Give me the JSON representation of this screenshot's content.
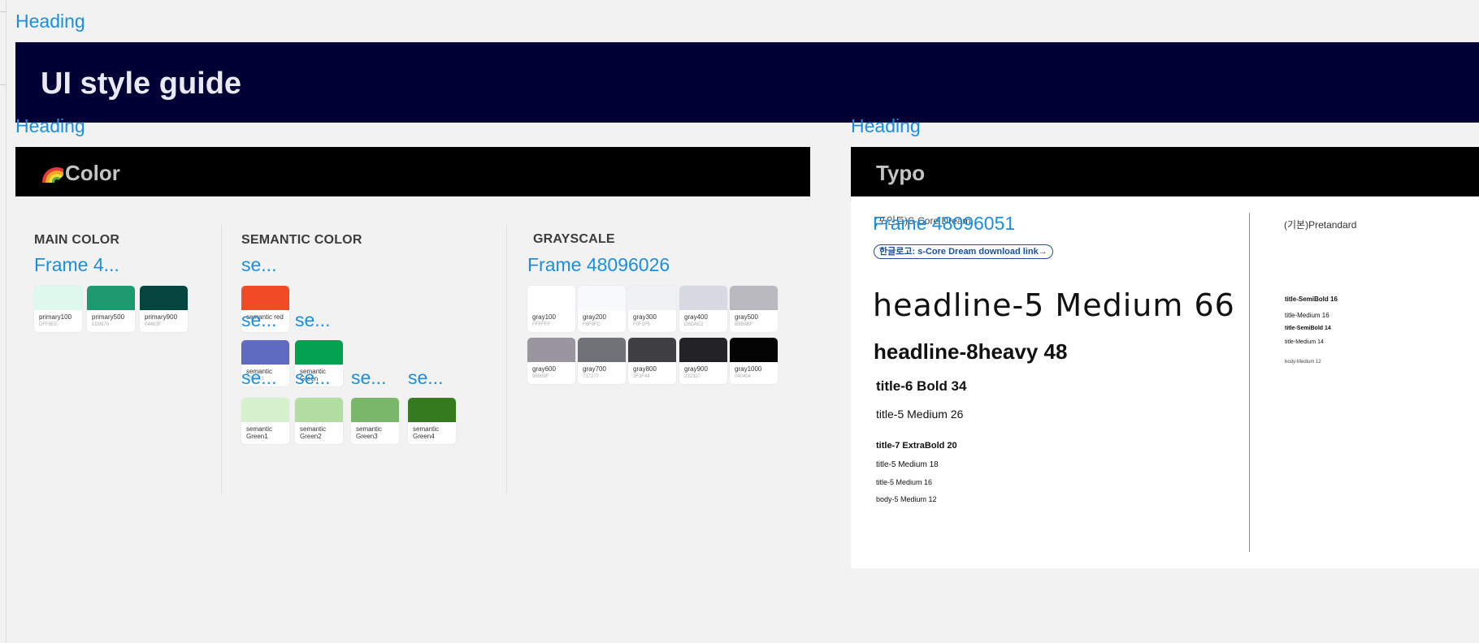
{
  "labels": {
    "heading_top": "Heading",
    "heading_color": "Heading",
    "heading_typo": "Heading",
    "frame_main": "Frame 4...",
    "frame_semantic": "se...",
    "frame_grayscale": "Frame 48096026",
    "frame_semantic_row2a": "se...",
    "frame_semantic_row2b": "se...",
    "frame_semantic_row3a": "se...",
    "frame_semantic_row3b": "se...",
    "frame_semantic_row3c": "se...",
    "frame_semantic_row3d": "se...",
    "frame_typo": "Frame 48096051"
  },
  "banner": {
    "title": "UI style guide",
    "background": "#010035"
  },
  "sections": {
    "color": {
      "title": "Color",
      "icon": "rainbow-icon"
    },
    "typo": {
      "title": "Typo"
    }
  },
  "color_groups": {
    "main": {
      "title": "MAIN COLOR",
      "swatches": [
        {
          "name": "primary100",
          "hex": "DFF8EE",
          "color": "#DFF8EE"
        },
        {
          "name": "primary500",
          "hex": "1D9970",
          "color": "#1D9970"
        },
        {
          "name": "primary900",
          "hex": "04463F",
          "color": "#04463F"
        }
      ]
    },
    "semantic": {
      "title": "SEMANTIC COLOR",
      "red": {
        "name": "semantic red",
        "color": "#F04B27"
      },
      "blue": {
        "name": "semantic",
        "hex": "5F6BC1",
        "color": "#5F6BC1"
      },
      "green": {
        "name": "semantic Green",
        "color": "#03A150"
      },
      "greens": [
        {
          "name": "semantic Green1",
          "hex": "D6F2CC",
          "color": "#D6F2CC"
        },
        {
          "name": "semantic Green2",
          "hex": "B2DDA2",
          "color": "#B2DDA2"
        },
        {
          "name": "semantic Green3",
          "hex": "7BB768",
          "color": "#7BB768"
        },
        {
          "name": "semantic Green4",
          "hex": "367A1F",
          "color": "#367A1F"
        }
      ]
    },
    "grayscale": {
      "title": "GRAYSCALE",
      "row1": [
        {
          "name": "gray100",
          "hex": "FFFFFF",
          "color": "#FFFFFF"
        },
        {
          "name": "gray200",
          "hex": "F8F9FC",
          "color": "#F8F9FC"
        },
        {
          "name": "gray300",
          "hex": "F0F1F5",
          "color": "#F0F1F5"
        },
        {
          "name": "gray400",
          "hex": "D8DAE2",
          "color": "#D8DAE2"
        },
        {
          "name": "gray500",
          "hex": "B9B9BF",
          "color": "#B9B9BF"
        }
      ],
      "row2": [
        {
          "name": "gray600",
          "hex": "99969F",
          "color": "#99969F"
        },
        {
          "name": "gray700",
          "hex": "717277",
          "color": "#717277"
        },
        {
          "name": "gray800",
          "hex": "3F3F44",
          "color": "#3F3F44"
        },
        {
          "name": "gray900",
          "hex": "232327",
          "color": "#232327"
        },
        {
          "name": "gray1000",
          "hex": "040404",
          "color": "#040404"
        }
      ]
    }
  },
  "typo": {
    "left_header": "(포인트)S-Core Dream",
    "link": "한글로고: s-Core Dream download link→",
    "samples_left": [
      "headline-5 Medium 66",
      "headline-8heavy 48",
      "title-6 Bold 34",
      "title-5 Medium 26",
      "title-7 ExtraBold 20",
      "title-5 Medium 18",
      "title-5 Medium 16",
      "body-5 Medium 12"
    ],
    "right_header": "(기본)Pretandard",
    "samples_right": [
      "title-SemiBold 16",
      "title-Medium 16",
      "title-SemiBold 14",
      "title-Medium 14",
      "body-Medium 12"
    ]
  }
}
